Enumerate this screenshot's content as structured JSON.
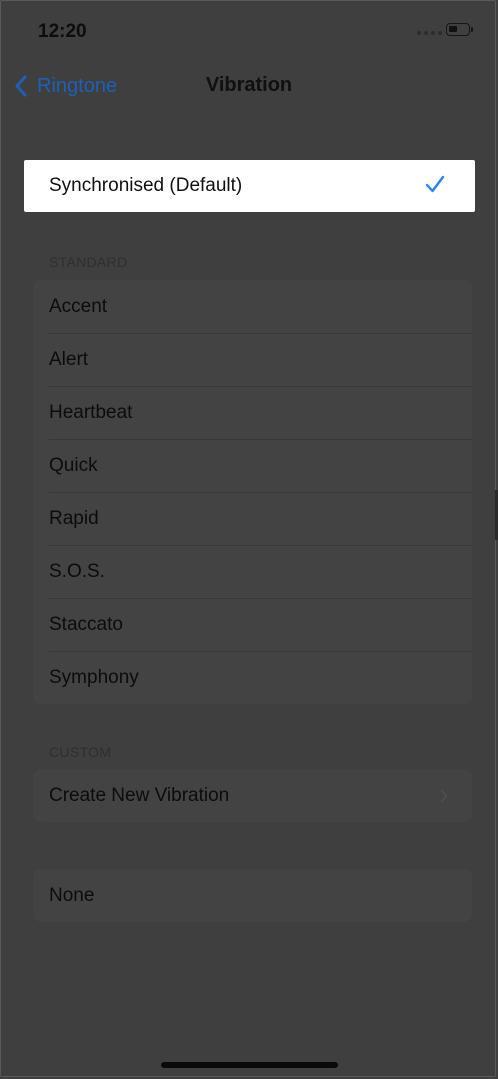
{
  "status_bar": {
    "time": "12:20"
  },
  "nav": {
    "back_label": "Ringtone",
    "title": "Vibration"
  },
  "selected": {
    "label": "Synchronised (Default)",
    "checked": true
  },
  "standard": {
    "header": "STANDARD",
    "items": [
      {
        "label": "Accent"
      },
      {
        "label": "Alert"
      },
      {
        "label": "Heartbeat"
      },
      {
        "label": "Quick"
      },
      {
        "label": "Rapid"
      },
      {
        "label": "S.O.S."
      },
      {
        "label": "Staccato"
      },
      {
        "label": "Symphony"
      }
    ]
  },
  "custom": {
    "header": "CUSTOM",
    "create_label": "Create New Vibration"
  },
  "none_label": "None",
  "colors": {
    "accent": "#1e60b8",
    "check": "#2a83f0",
    "overlay_bg": "#3f3f3f"
  }
}
